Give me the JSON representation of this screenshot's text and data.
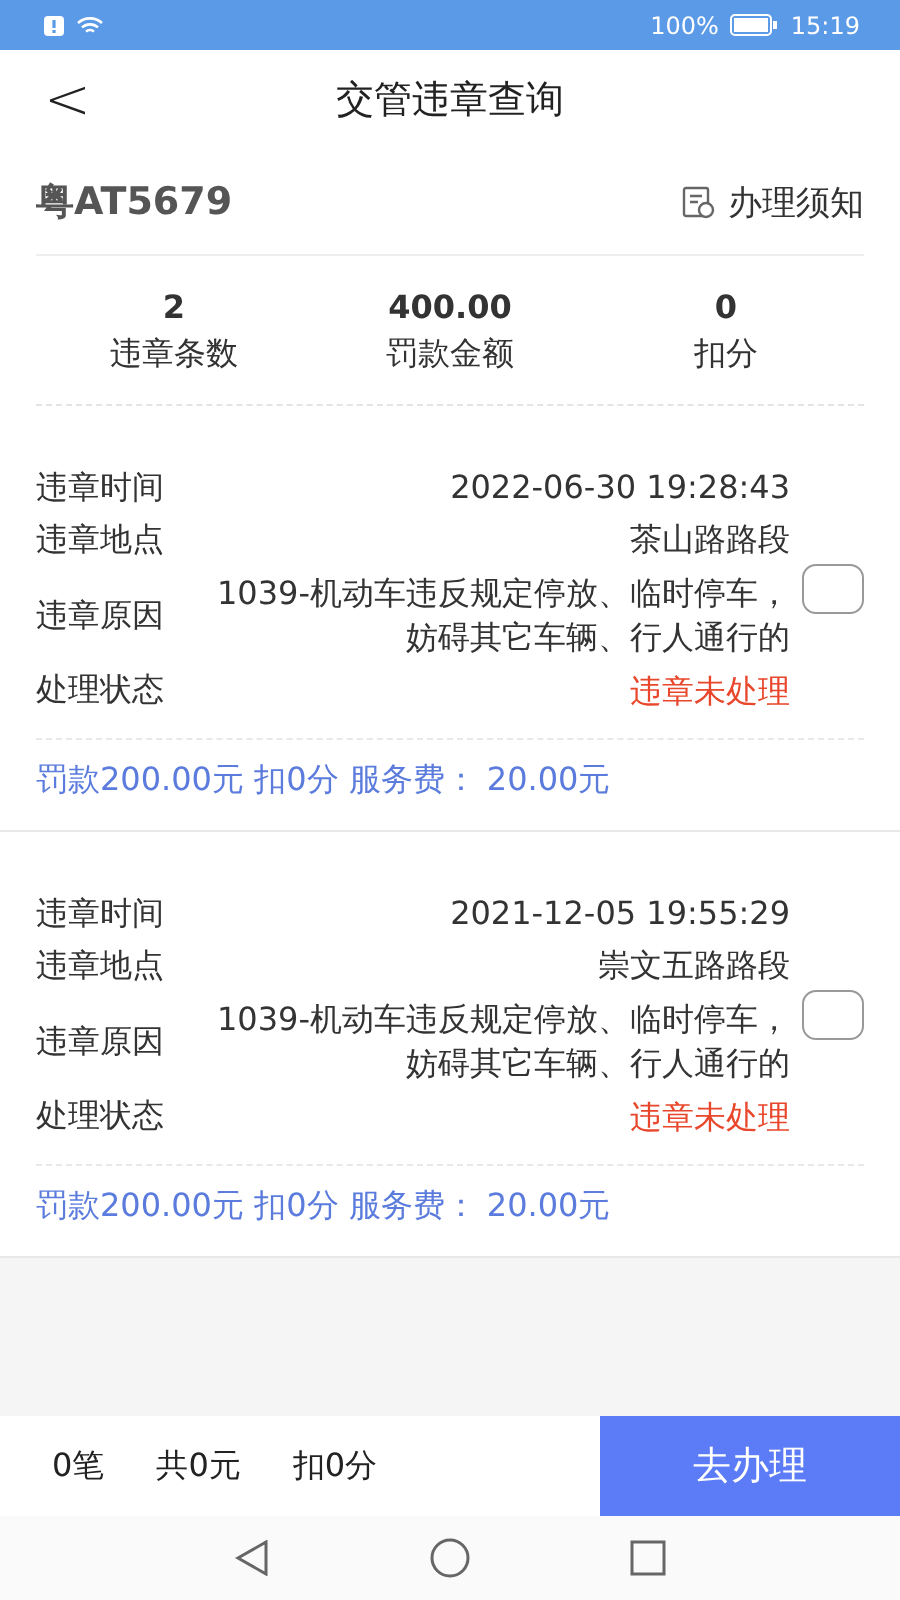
{
  "status_bar": {
    "battery_percent": "100%",
    "time": "15:19"
  },
  "header": {
    "back": "<",
    "title": "交管违章查询"
  },
  "plate": {
    "number": "粤AT5679",
    "notice_link": "办理须知"
  },
  "summary": [
    {
      "value": "2",
      "label": "违章条数"
    },
    {
      "value": "400.00",
      "label": "罚款金额"
    },
    {
      "value": "0",
      "label": "扣分"
    }
  ],
  "records": [
    {
      "fields": [
        {
          "label": "违章时间",
          "value": "2022-06-30 19:28:43",
          "kind": "plain"
        },
        {
          "label": "违章地点",
          "value": "茶山路路段",
          "kind": "plain"
        },
        {
          "label": "违章原因",
          "value": "1039-机动车违反规定停放、临时停车，妨碍其它车辆、行人通行的",
          "kind": "plain"
        },
        {
          "label": "处理状态",
          "value": "违章未处理",
          "kind": "alert"
        }
      ],
      "checked": false,
      "fee_line": "罚款200.00元 扣0分 服务费： 20.00元"
    },
    {
      "fields": [
        {
          "label": "违章时间",
          "value": "2021-12-05 19:55:29",
          "kind": "plain"
        },
        {
          "label": "违章地点",
          "value": "崇文五路路段",
          "kind": "plain"
        },
        {
          "label": "违章原因",
          "value": "1039-机动车违反规定停放、临时停车，妨碍其它车辆、行人通行的",
          "kind": "plain"
        },
        {
          "label": "处理状态",
          "value": "违章未处理",
          "kind": "alert"
        }
      ],
      "checked": false,
      "fee_line": "罚款200.00元 扣0分 服务费： 20.00元"
    }
  ],
  "footer": {
    "count": "0笔",
    "total": "共0元",
    "points": "扣0分",
    "action": "去办理"
  }
}
